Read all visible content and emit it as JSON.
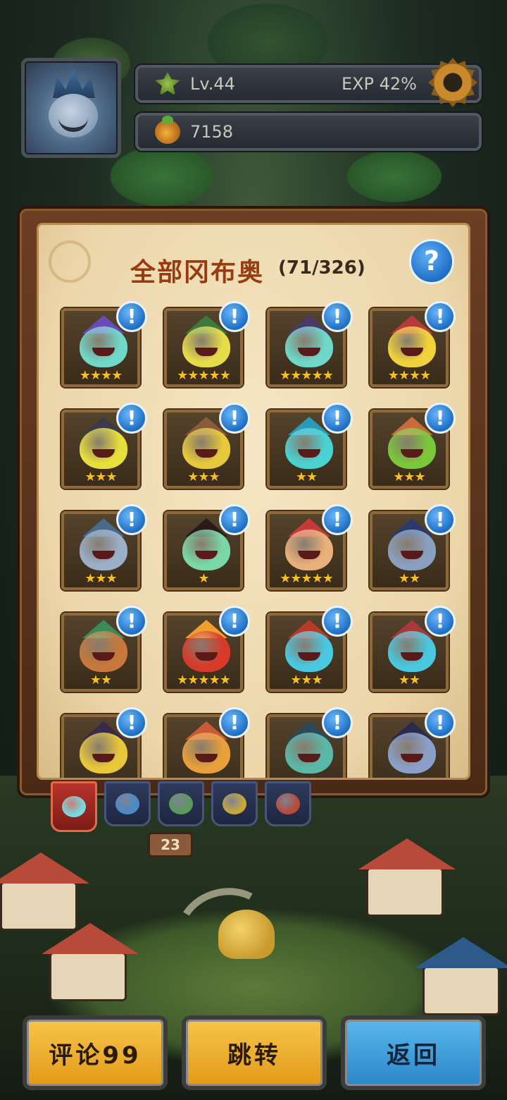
{
  "hud": {
    "level": "Lv.44",
    "exp": "EXP 42%",
    "coins": "7158"
  },
  "collection": {
    "title": "全部冈布奥",
    "count": "(71/326)",
    "help_symbol": "?",
    "info_symbol": "!",
    "cards": [
      {
        "stars": "★★★★",
        "body": "#6fd8c8",
        "hat": "#6a4ab8"
      },
      {
        "stars": "★★★★★",
        "body": "#e6dc4a",
        "hat": "#3a7a3a"
      },
      {
        "stars": "★★★★★",
        "body": "#6fd8c8",
        "hat": "#4a3a6a"
      },
      {
        "stars": "★★★★",
        "body": "#f2d23a",
        "hat": "#b83a3a"
      },
      {
        "stars": "★★★",
        "body": "#e8e03a",
        "hat": "#3a3a4a"
      },
      {
        "stars": "★★★",
        "body": "#e6c83a",
        "hat": "#8a5a3a"
      },
      {
        "stars": "★★",
        "body": "#4ad2d2",
        "hat": "#2a9ab8"
      },
      {
        "stars": "★★★",
        "body": "#7ac83a",
        "hat": "#c86a3a"
      },
      {
        "stars": "★★★",
        "body": "#9ab0c8",
        "hat": "#4a6a8a"
      },
      {
        "stars": "★",
        "body": "#7ad8a8",
        "hat": "#2a1a1a"
      },
      {
        "stars": "★★★★★",
        "body": "#e8b07a",
        "hat": "#c83a3a"
      },
      {
        "stars": "★★",
        "body": "#8aa0c0",
        "hat": "#2a3a6a"
      },
      {
        "stars": "★★",
        "body": "#c8783a",
        "hat": "#3a8a5a"
      },
      {
        "stars": "★★★★★",
        "body": "#d83a2a",
        "hat": "#f0a02a"
      },
      {
        "stars": "★★★",
        "body": "#4ac8e0",
        "hat": "#b83a2a"
      },
      {
        "stars": "★★",
        "body": "#4ac8e0",
        "hat": "#a83a3a"
      },
      {
        "stars": "",
        "body": "#e8c83a",
        "hat": "#3a2a4a"
      },
      {
        "stars": "",
        "body": "#e8a03a",
        "hat": "#c85a3a"
      },
      {
        "stars": "",
        "body": "#5ab8a8",
        "hat": "#2a4a5a"
      },
      {
        "stars": "",
        "body": "#8aa0c8",
        "hat": "#2a2a4a"
      }
    ]
  },
  "tabs": [
    {
      "name": "all",
      "active": true,
      "color": "#7ad8e0"
    },
    {
      "name": "blue",
      "active": false,
      "color": "#4a8ac8"
    },
    {
      "name": "green",
      "active": false,
      "color": "#5a9a5a"
    },
    {
      "name": "yellow",
      "active": false,
      "color": "#c8a83a"
    },
    {
      "name": "red",
      "active": false,
      "color": "#b84a3a"
    }
  ],
  "scene": {
    "sign_number": "23"
  },
  "buttons": {
    "comment": "评论99",
    "jump": "跳转",
    "back": "返回"
  },
  "colors": {
    "accent_yellow": "#f6c54a",
    "accent_blue": "#2a86c8",
    "title_red": "#9a3a12"
  }
}
